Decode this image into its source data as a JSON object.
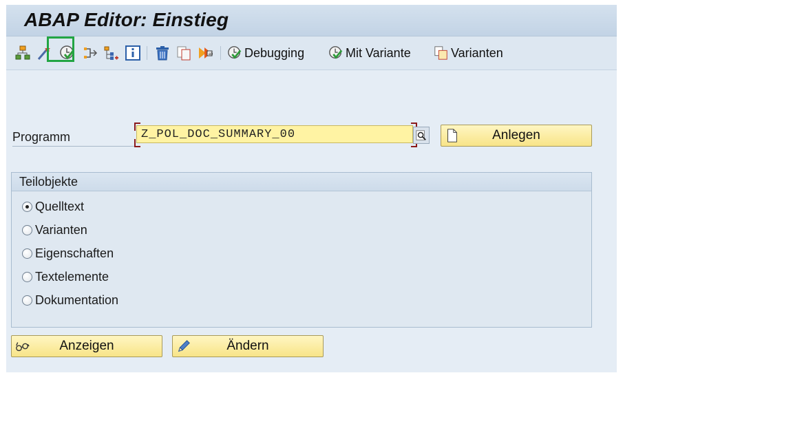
{
  "window": {
    "title": "ABAP Editor: Einstieg"
  },
  "toolbar": {
    "icons": [
      "hierarchy-icon",
      "magic-wand-icon",
      "check-clock-icon",
      "where-used-icon",
      "object-list-icon",
      "info-icon",
      "delete-icon",
      "copy-icon",
      "rename-icon"
    ],
    "debugging_label": "Debugging",
    "with_variant_label": "Mit Variante",
    "variants_label": "Varianten"
  },
  "program": {
    "label": "Programm",
    "value": "Z_POL_DOC_SUMMARY_00",
    "create_label": "Anlegen"
  },
  "subobjects": {
    "title": "Teilobjekte",
    "selected": "Quelltext",
    "options": [
      {
        "label": "Quelltext"
      },
      {
        "label": "Varianten"
      },
      {
        "label": "Eigenschaften"
      },
      {
        "label": "Textelemente"
      },
      {
        "label": "Dokumentation"
      }
    ]
  },
  "actions": {
    "display_label": "Anzeigen",
    "change_label": "Ändern"
  },
  "colors": {
    "highlight": "#22a543",
    "input_bg": "#fff3a3",
    "button_bg": "#f8e488",
    "app_bg": "#e5edf5"
  }
}
